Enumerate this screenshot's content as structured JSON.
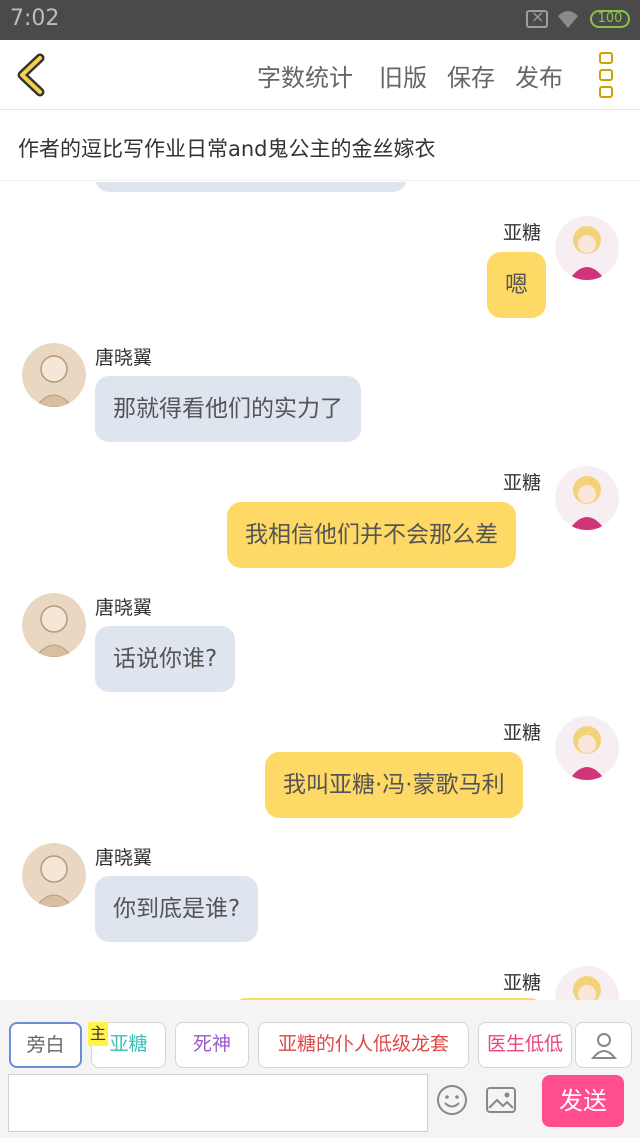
{
  "status_bar": {
    "time": "7:02",
    "battery": "100"
  },
  "toolbar": {
    "word_count": "字数统计",
    "old_version": "旧版",
    "save": "保存",
    "publish": "发布"
  },
  "title": "作者的逗比写作业日常and鬼公主的金丝嫁衣",
  "messages": [
    {
      "side": "right",
      "name": "亚糖",
      "text": "嗯"
    },
    {
      "side": "left",
      "name": "唐晓翼",
      "text": "那就得看他们的实力了"
    },
    {
      "side": "right",
      "name": "亚糖",
      "text": "我相信他们并不会那么差"
    },
    {
      "side": "left",
      "name": "唐晓翼",
      "text": "话说你谁?"
    },
    {
      "side": "right",
      "name": "亚糖",
      "text": "我叫亚糖·冯·蒙歌马利"
    },
    {
      "side": "left",
      "name": "唐晓翼",
      "text": "你到底是谁?"
    },
    {
      "side": "right",
      "name": "亚糖",
      "text": ""
    }
  ],
  "characters": {
    "narration": "旁白",
    "main_badge": "主",
    "items": [
      "亚糖",
      "死神",
      "亚糖的仆人低级龙套",
      "医生低低"
    ],
    "colors": [
      "#3cbfb4",
      "#9b59d0",
      "#e04848",
      "#e8457f"
    ]
  },
  "input": {
    "placeholder": "",
    "send_label": "发送"
  },
  "colors": {
    "accent_yellow": "#ffd966",
    "left_bubble": "#dfe5ee",
    "send": "#ff4d8d"
  }
}
